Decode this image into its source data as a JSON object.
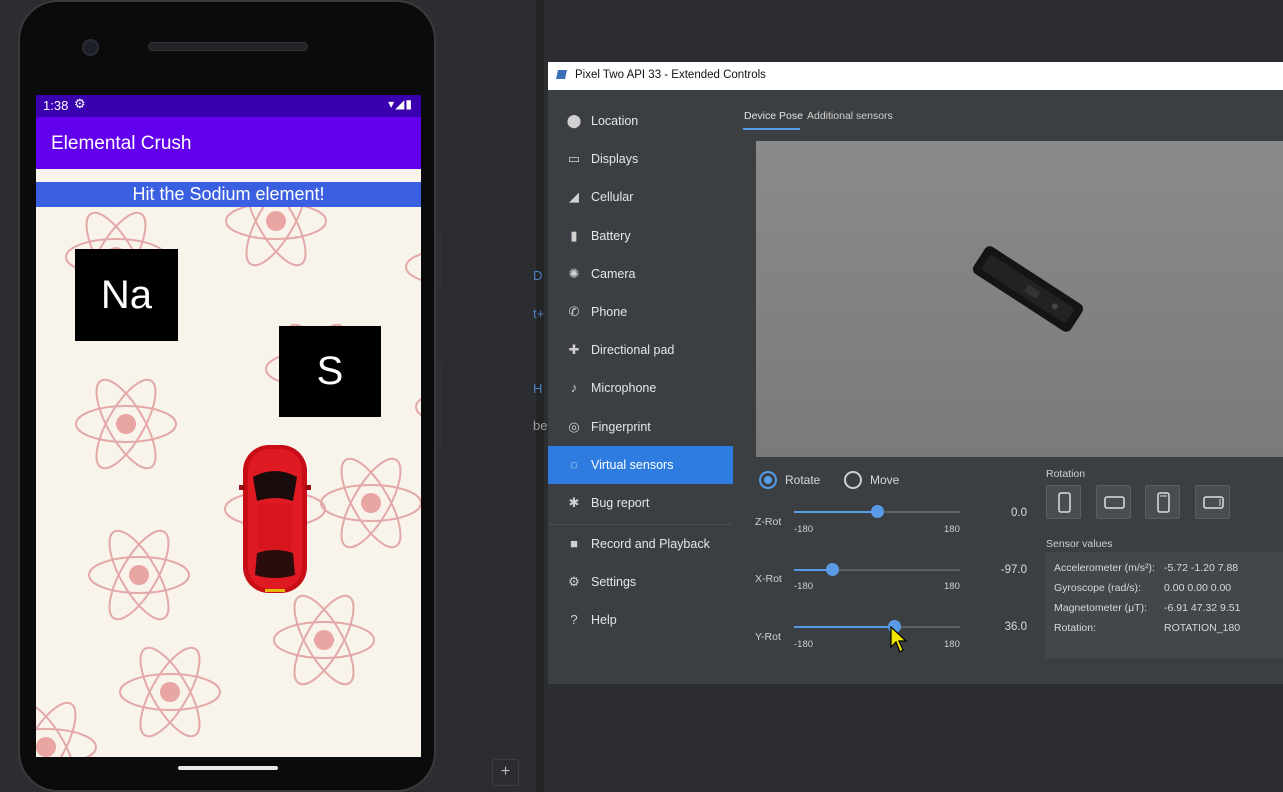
{
  "phone": {
    "status_time": "1:38",
    "app_title": "Elemental Crush",
    "prompt": "Hit the Sodium element!",
    "tiles": [
      "Na",
      "S"
    ]
  },
  "ide": {
    "plus_label": "+",
    "fragments": [
      "D",
      "t+",
      "H",
      "be"
    ]
  },
  "emulator": {
    "window_title": "Pixel Two API 33 - Extended Controls",
    "sidebar": [
      {
        "label": "Location",
        "icon": "location-pin-icon"
      },
      {
        "label": "Displays",
        "icon": "display-icon"
      },
      {
        "label": "Cellular",
        "icon": "cellular-signal-icon"
      },
      {
        "label": "Battery",
        "icon": "battery-icon"
      },
      {
        "label": "Camera",
        "icon": "camera-aperture-icon"
      },
      {
        "label": "Phone",
        "icon": "phone-handset-icon"
      },
      {
        "label": "Directional pad",
        "icon": "dpad-icon"
      },
      {
        "label": "Microphone",
        "icon": "microphone-icon"
      },
      {
        "label": "Fingerprint",
        "icon": "fingerprint-icon"
      },
      {
        "label": "Virtual sensors",
        "icon": "sensors-icon",
        "active": true
      },
      {
        "label": "Bug report",
        "icon": "bug-icon"
      },
      {
        "label": "Record and Playback",
        "icon": "video-camera-icon"
      },
      {
        "label": "Settings",
        "icon": "gear-icon"
      },
      {
        "label": "Help",
        "icon": "help-icon"
      }
    ],
    "tabs": [
      "Device Pose",
      "Additional sensors"
    ],
    "mode": {
      "rotate": "Rotate",
      "move": "Move",
      "selected": "rotate"
    },
    "sliders": [
      {
        "axis": "Z-Rot",
        "min": "-180",
        "max": "180",
        "value": "0.0",
        "level": 0.5
      },
      {
        "axis": "X-Rot",
        "min": "-180",
        "max": "180",
        "value": "-97.0",
        "level": 0.23
      },
      {
        "axis": "Y-Rot",
        "min": "-180",
        "max": "180",
        "value": "36.0",
        "level": 0.6
      }
    ],
    "rotation_label": "Rotation",
    "sensor_values_label": "Sensor values",
    "sensors": [
      {
        "name": "Accelerometer (m/s²):",
        "values": "-5.72   -1.20   7.88"
      },
      {
        "name": "Gyroscope (rad/s):",
        "values": "0.00    0.00    0.00"
      },
      {
        "name": "Magnetometer (μT):",
        "values": "-6.91   47.32  9.51"
      },
      {
        "name": "Rotation:",
        "values": "ROTATION_180"
      }
    ]
  }
}
